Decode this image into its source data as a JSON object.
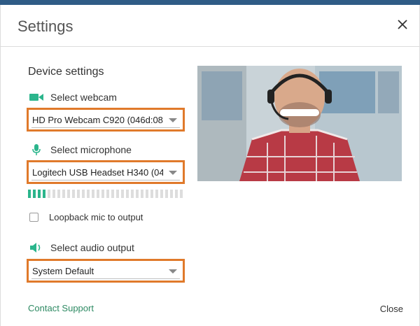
{
  "dialog": {
    "title": "Settings",
    "close_icon": "close-icon"
  },
  "device_settings": {
    "heading": "Device settings",
    "webcam": {
      "label": "Select webcam",
      "icon": "video-camera-icon",
      "selected": "HD Pro Webcam C920 (046d:082"
    },
    "microphone": {
      "label": "Select microphone",
      "icon": "microphone-icon",
      "selected": "Logitech USB Headset H340 (04",
      "level_fraction": 0.12
    },
    "loopback": {
      "label": "Loopback mic to output",
      "checked": false
    },
    "audio_output": {
      "label": "Select audio output",
      "icon": "speaker-icon",
      "selected": "System Default"
    }
  },
  "footer": {
    "support_link": "Contact Support",
    "close_label": "Close"
  },
  "colors": {
    "accent_green": "#2bb58c",
    "highlight_orange": "#e07a2b",
    "link_green": "#2e8a63",
    "top_bar": "#2f5c86"
  }
}
